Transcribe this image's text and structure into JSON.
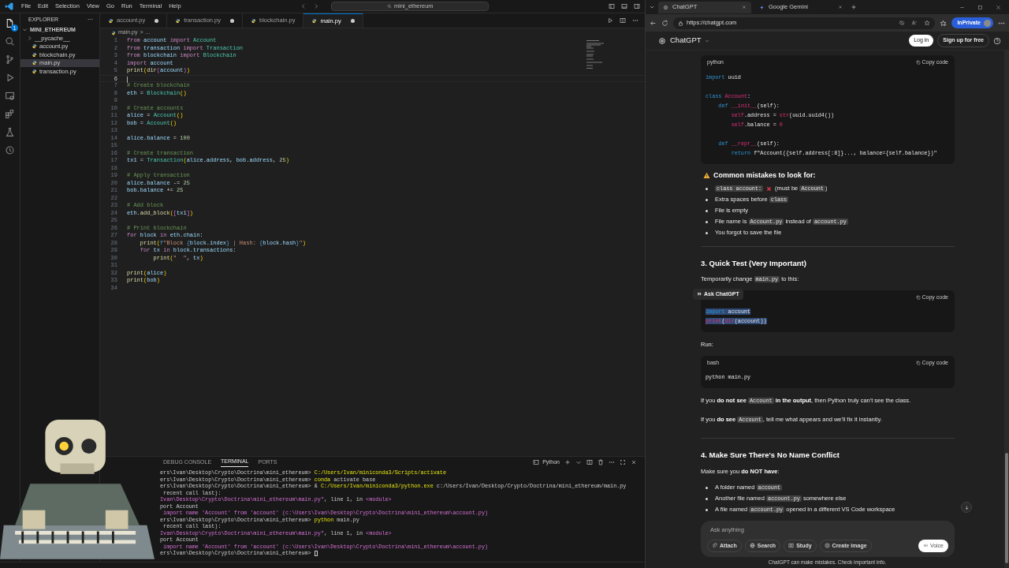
{
  "vscode": {
    "menu": [
      "File",
      "Edit",
      "Selection",
      "View",
      "Go",
      "Run",
      "Terminal",
      "Help"
    ],
    "search": "mini_ethereum",
    "activity_badge": "1",
    "explorer": {
      "title": "EXPLORER",
      "more": "···",
      "root": {
        "label": "MINI_ETHEREUM",
        "expanded": true,
        "children": [
          {
            "label": "__pycache__",
            "kind": "folder",
            "expanded": false,
            "selected": false
          },
          {
            "label": "account.py",
            "kind": "file",
            "selected": false
          },
          {
            "label": "blockchain.py",
            "kind": "file",
            "selected": false
          },
          {
            "label": "main.py",
            "kind": "file",
            "selected": true
          },
          {
            "label": "transaction.py",
            "kind": "file",
            "selected": false
          }
        ]
      }
    },
    "tabs": [
      {
        "label": "account.py",
        "modified": true,
        "selected": false
      },
      {
        "label": "transaction.py",
        "modified": true,
        "selected": false
      },
      {
        "label": "blockchain.py",
        "modified": false,
        "selected": false
      },
      {
        "label": "main.py",
        "modified": true,
        "selected": true
      }
    ],
    "breadcrumb": [
      "main.py",
      ">",
      "..."
    ],
    "lines": [
      {
        "n": "1",
        "current": false,
        "kind": "code",
        "t": [
          {
            "kind": "k",
            "text": "from "
          },
          {
            "kind": "v",
            "text": "account "
          },
          {
            "kind": "k",
            "text": "import "
          },
          {
            "kind": "c",
            "text": "Account"
          }
        ]
      },
      {
        "n": "2",
        "current": false,
        "kind": "code",
        "t": [
          {
            "kind": "k",
            "text": "from "
          },
          {
            "kind": "v",
            "text": "transaction "
          },
          {
            "kind": "k",
            "text": "import "
          },
          {
            "kind": "c",
            "text": "Transaction"
          }
        ]
      },
      {
        "n": "3",
        "current": false,
        "kind": "code",
        "t": [
          {
            "kind": "k",
            "text": "from "
          },
          {
            "kind": "v",
            "text": "blockchain "
          },
          {
            "kind": "k",
            "text": "import "
          },
          {
            "kind": "c",
            "text": "Blockchain"
          }
        ]
      },
      {
        "n": "4",
        "current": false,
        "kind": "code",
        "t": [
          {
            "kind": "k",
            "text": "import "
          },
          {
            "kind": "v",
            "text": "account"
          }
        ]
      },
      {
        "n": "5",
        "current": false,
        "kind": "code",
        "t": [
          {
            "kind": "f",
            "text": "print"
          },
          {
            "kind": "y",
            "text": "("
          },
          {
            "kind": "f",
            "text": "dir"
          },
          {
            "kind": "o",
            "text": "("
          },
          {
            "kind": "v",
            "text": "account"
          },
          {
            "kind": "o",
            "text": ")"
          },
          {
            "kind": "y",
            "text": ")"
          }
        ]
      },
      {
        "n": "6",
        "current": true,
        "kind": "blank"
      },
      {
        "n": "7",
        "current": false,
        "kind": "code",
        "t": [
          {
            "kind": "m",
            "text": "# Create blockchain"
          }
        ]
      },
      {
        "n": "8",
        "current": false,
        "kind": "code",
        "t": [
          {
            "kind": "v",
            "text": "eth "
          },
          {
            "kind": "p",
            "text": "= "
          },
          {
            "kind": "c",
            "text": "Blockchain"
          },
          {
            "kind": "y",
            "text": "()"
          }
        ]
      },
      {
        "n": "9",
        "current": false,
        "kind": "blank"
      },
      {
        "n": "10",
        "current": false,
        "kind": "code",
        "t": [
          {
            "kind": "m",
            "text": "# Create accounts"
          }
        ]
      },
      {
        "n": "11",
        "current": false,
        "kind": "code",
        "t": [
          {
            "kind": "v",
            "text": "alice "
          },
          {
            "kind": "p",
            "text": "= "
          },
          {
            "kind": "c",
            "text": "Account"
          },
          {
            "kind": "y",
            "text": "()"
          }
        ]
      },
      {
        "n": "12",
        "current": false,
        "kind": "code",
        "t": [
          {
            "kind": "v",
            "text": "bob "
          },
          {
            "kind": "p",
            "text": "= "
          },
          {
            "kind": "c",
            "text": "Account"
          },
          {
            "kind": "y",
            "text": "()"
          }
        ]
      },
      {
        "n": "13",
        "current": false,
        "kind": "blank"
      },
      {
        "n": "14",
        "current": false,
        "kind": "code",
        "t": [
          {
            "kind": "v",
            "text": "alice"
          },
          {
            "kind": "p",
            "text": "."
          },
          {
            "kind": "v",
            "text": "balance "
          },
          {
            "kind": "p",
            "text": "= "
          },
          {
            "kind": "n",
            "text": "100"
          }
        ]
      },
      {
        "n": "15",
        "current": false,
        "kind": "blank"
      },
      {
        "n": "16",
        "current": false,
        "kind": "code",
        "t": [
          {
            "kind": "m",
            "text": "# Create transaction"
          }
        ]
      },
      {
        "n": "17",
        "current": false,
        "kind": "code",
        "t": [
          {
            "kind": "v",
            "text": "tx1 "
          },
          {
            "kind": "p",
            "text": "= "
          },
          {
            "kind": "c",
            "text": "Transaction"
          },
          {
            "kind": "y",
            "text": "("
          },
          {
            "kind": "v",
            "text": "alice"
          },
          {
            "kind": "p",
            "text": "."
          },
          {
            "kind": "v",
            "text": "address"
          },
          {
            "kind": "p",
            "text": ", "
          },
          {
            "kind": "v",
            "text": "bob"
          },
          {
            "kind": "p",
            "text": "."
          },
          {
            "kind": "v",
            "text": "address"
          },
          {
            "kind": "p",
            "text": ", "
          },
          {
            "kind": "n",
            "text": "25"
          },
          {
            "kind": "y",
            "text": ")"
          }
        ]
      },
      {
        "n": "18",
        "current": false,
        "kind": "blank"
      },
      {
        "n": "19",
        "current": false,
        "kind": "code",
        "t": [
          {
            "kind": "m",
            "text": "# Apply transaction"
          }
        ]
      },
      {
        "n": "20",
        "current": false,
        "kind": "code",
        "t": [
          {
            "kind": "v",
            "text": "alice"
          },
          {
            "kind": "p",
            "text": "."
          },
          {
            "kind": "v",
            "text": "balance "
          },
          {
            "kind": "p",
            "text": "-= "
          },
          {
            "kind": "n",
            "text": "25"
          }
        ]
      },
      {
        "n": "21",
        "current": false,
        "kind": "code",
        "t": [
          {
            "kind": "v",
            "text": "bob"
          },
          {
            "kind": "p",
            "text": "."
          },
          {
            "kind": "v",
            "text": "balance "
          },
          {
            "kind": "p",
            "text": "+= "
          },
          {
            "kind": "n",
            "text": "25"
          }
        ]
      },
      {
        "n": "22",
        "current": false,
        "kind": "blank"
      },
      {
        "n": "23",
        "current": false,
        "kind": "code",
        "t": [
          {
            "kind": "m",
            "text": "# Add block"
          }
        ]
      },
      {
        "n": "24",
        "current": false,
        "kind": "code",
        "t": [
          {
            "kind": "v",
            "text": "eth"
          },
          {
            "kind": "p",
            "text": "."
          },
          {
            "kind": "f",
            "text": "add_block"
          },
          {
            "kind": "y",
            "text": "("
          },
          {
            "kind": "o",
            "text": "["
          },
          {
            "kind": "v",
            "text": "tx1"
          },
          {
            "kind": "o",
            "text": "]"
          },
          {
            "kind": "y",
            "text": ")"
          }
        ]
      },
      {
        "n": "25",
        "current": false,
        "kind": "blank"
      },
      {
        "n": "26",
        "current": false,
        "kind": "code",
        "t": [
          {
            "kind": "m",
            "text": "# Print blockchain"
          }
        ]
      },
      {
        "n": "27",
        "current": false,
        "kind": "code",
        "t": [
          {
            "kind": "k",
            "text": "for "
          },
          {
            "kind": "v",
            "text": "block "
          },
          {
            "kind": "k",
            "text": "in "
          },
          {
            "kind": "v",
            "text": "eth"
          },
          {
            "kind": "p",
            "text": "."
          },
          {
            "kind": "v",
            "text": "chain"
          },
          {
            "kind": "p",
            "text": ":"
          }
        ]
      },
      {
        "n": "28",
        "current": false,
        "kind": "code",
        "t": [
          {
            "kind": "f",
            "text": "    print"
          },
          {
            "kind": "y",
            "text": "("
          },
          {
            "kind": "b",
            "text": "f"
          },
          {
            "kind": "s",
            "text": "\"Block "
          },
          {
            "kind": "b",
            "text": "{"
          },
          {
            "kind": "v",
            "text": "block"
          },
          {
            "kind": "p",
            "text": "."
          },
          {
            "kind": "v",
            "text": "index"
          },
          {
            "kind": "b",
            "text": "}"
          },
          {
            "kind": "s",
            "text": " | Hash: "
          },
          {
            "kind": "b",
            "text": "{"
          },
          {
            "kind": "v",
            "text": "block"
          },
          {
            "kind": "p",
            "text": "."
          },
          {
            "kind": "v",
            "text": "hash"
          },
          {
            "kind": "b",
            "text": "}"
          },
          {
            "kind": "s",
            "text": "\""
          },
          {
            "kind": "y",
            "text": ")"
          }
        ]
      },
      {
        "n": "29",
        "current": false,
        "kind": "code",
        "t": [
          {
            "kind": "k",
            "text": "    for "
          },
          {
            "kind": "v",
            "text": "tx "
          },
          {
            "kind": "k",
            "text": "in "
          },
          {
            "kind": "v",
            "text": "block"
          },
          {
            "kind": "p",
            "text": "."
          },
          {
            "kind": "v",
            "text": "transactions"
          },
          {
            "kind": "p",
            "text": ":"
          }
        ]
      },
      {
        "n": "30",
        "current": false,
        "kind": "code",
        "t": [
          {
            "kind": "f",
            "text": "        print"
          },
          {
            "kind": "y",
            "text": "("
          },
          {
            "kind": "s",
            "text": "\"  \""
          },
          {
            "kind": "p",
            "text": ", "
          },
          {
            "kind": "v",
            "text": "tx"
          },
          {
            "kind": "y",
            "text": ")"
          }
        ]
      },
      {
        "n": "31",
        "current": false,
        "kind": "blank"
      },
      {
        "n": "32",
        "current": false,
        "kind": "code",
        "t": [
          {
            "kind": "f",
            "text": "print"
          },
          {
            "kind": "y",
            "text": "("
          },
          {
            "kind": "v",
            "text": "alice"
          },
          {
            "kind": "y",
            "text": ")"
          }
        ]
      },
      {
        "n": "33",
        "current": false,
        "kind": "code",
        "t": [
          {
            "kind": "f",
            "text": "print"
          },
          {
            "kind": "y",
            "text": "("
          },
          {
            "kind": "v",
            "text": "bob"
          },
          {
            "kind": "y",
            "text": ")"
          }
        ]
      },
      {
        "n": "34",
        "current": false,
        "kind": "blank"
      }
    ],
    "panel_tabs": [
      {
        "label": "DEBUG CONSOLE",
        "selected": false
      },
      {
        "label": "TERMINAL",
        "selected": true
      },
      {
        "label": "PORTS",
        "selected": false
      }
    ],
    "terminal_profile": "Python",
    "terminal": [
      [
        {
          "kind": "p",
          "text": "ers\\Ivan\\Desktop\\Crypto\\Doctrina\\mini_ethereum> "
        },
        {
          "kind": "y",
          "text": "C:/Users/Ivan/miniconda3/Scripts/activate"
        }
      ],
      [
        {
          "kind": "p",
          "text": "ers\\Ivan\\Desktop\\Crypto\\Doctrina\\mini_ethereum> "
        },
        {
          "kind": "y",
          "text": "conda "
        },
        {
          "kind": "p",
          "text": "activate base"
        }
      ],
      [
        {
          "kind": "p",
          "text": "ers\\Ivan\\Desktop\\Crypto\\Doctrina\\mini_ethereum> & "
        },
        {
          "kind": "y",
          "text": "C:/Users/Ivan/miniconda3/python.exe "
        },
        {
          "kind": "p",
          "text": "c:/Users/Ivan/Desktop/Crypto/Doctrina/mini_ethereum/main.py"
        }
      ],
      [
        {
          "kind": "p",
          "text": " recent call last):"
        }
      ],
      [
        {
          "kind": "r",
          "text": "Ivan\\Desktop\\Crypto\\Doctrina\\mini_ethereum\\main.py\""
        },
        {
          "kind": "p",
          "text": ", line 1, in "
        },
        {
          "kind": "r",
          "text": "<module>"
        }
      ],
      [
        {
          "kind": "p",
          "text": "port Account"
        }
      ],
      [
        {
          "kind": "r",
          "text": " import name 'Account' from 'account' (c:\\Users\\Ivan\\Desktop\\Crypto\\Doctrina\\mini_ethereum\\account.py)"
        }
      ],
      [
        {
          "kind": "p",
          "text": "ers\\Ivan\\Desktop\\Crypto\\Doctrina\\mini_ethereum> "
        },
        {
          "kind": "y",
          "text": "python "
        },
        {
          "kind": "p",
          "text": "main.py"
        }
      ],
      [
        {
          "kind": "p",
          "text": " recent call last):"
        }
      ],
      [
        {
          "kind": "r",
          "text": "Ivan\\Desktop\\Crypto\\Doctrina\\mini_ethereum\\main.py\""
        },
        {
          "kind": "p",
          "text": ", line 1, in "
        },
        {
          "kind": "r",
          "text": "<module>"
        }
      ],
      [
        {
          "kind": "p",
          "text": "port Account"
        }
      ],
      [
        {
          "kind": "r",
          "text": " import name 'Account' from 'account' (c:\\Users\\Ivan\\Desktop\\Crypto\\Doctrina\\mini_ethereum\\account.py)"
        }
      ],
      [
        {
          "kind": "p",
          "text": "ers\\Ivan\\Desktop\\Crypto\\Doctrina\\mini_ethereum> "
        }
      ]
    ]
  },
  "browser": {
    "tabs": [
      {
        "label": "ChatGPT",
        "selected": true
      },
      {
        "label": "Google Gemini",
        "selected": false
      }
    ],
    "url": "https://chatgpt.com",
    "inprivate": "InPrivate"
  },
  "chat": {
    "brand": "ChatGPT",
    "login": "Log in",
    "signup": "Sign up for free",
    "blocks": [
      {
        "kind": "code",
        "lang": "python",
        "copy": "Copy code",
        "selected": false,
        "lines": [
          {
            "kind": "code",
            "t": [
              {
                "kind": "k",
                "text": "import "
              },
              {
                "kind": "p",
                "text": "uuid"
              }
            ]
          },
          {
            "kind": "blank"
          },
          {
            "kind": "code",
            "t": [
              {
                "kind": "k",
                "text": "class "
              },
              {
                "kind": "r",
                "text": "Account"
              },
              {
                "kind": "p",
                "text": ":"
              }
            ]
          },
          {
            "kind": "code",
            "t": [
              {
                "kind": "k",
                "text": "    def "
              },
              {
                "kind": "r",
                "text": "__init__"
              },
              {
                "kind": "p",
                "text": "(self):"
              }
            ]
          },
          {
            "kind": "code",
            "t": [
              {
                "kind": "r",
                "text": "        self"
              },
              {
                "kind": "p",
                "text": ".address = "
              },
              {
                "kind": "r",
                "text": "str"
              },
              {
                "kind": "p",
                "text": "(uuid.uuid4())"
              }
            ]
          },
          {
            "kind": "code",
            "t": [
              {
                "kind": "r",
                "text": "        self"
              },
              {
                "kind": "p",
                "text": ".balance = "
              },
              {
                "kind": "r",
                "text": "0"
              }
            ]
          },
          {
            "kind": "blank"
          },
          {
            "kind": "code",
            "t": [
              {
                "kind": "k",
                "text": "    def "
              },
              {
                "kind": "r",
                "text": "__repr__"
              },
              {
                "kind": "p",
                "text": "(self):"
              }
            ]
          },
          {
            "kind": "code",
            "t": [
              {
                "kind": "k",
                "text": "        return "
              },
              {
                "kind": "p",
                "text": "f\"Account({self.address[:8]}..., balance={self.balance})\""
              }
            ]
          }
        ]
      },
      {
        "kind": "heading",
        "parts": [
          {
            "kind": "t",
            "text": "Common mistakes to look for:"
          }
        ]
      },
      {
        "kind": "bullets",
        "items": [
          [
            {
              "kind": "c",
              "text": "class account:"
            },
            {
              "kind": "x"
            },
            {
              "kind": "t",
              "text": " (must be "
            },
            {
              "kind": "c",
              "text": "Account"
            },
            {
              "kind": "t",
              "text": ")"
            }
          ],
          [
            {
              "kind": "t",
              "text": "Extra spaces before "
            },
            {
              "kind": "c",
              "text": "class"
            }
          ],
          [
            {
              "kind": "t",
              "text": "File is empty"
            }
          ],
          [
            {
              "kind": "t",
              "text": "File name is "
            },
            {
              "kind": "c",
              "text": "Account.py"
            },
            {
              "kind": "t",
              "text": " instead of "
            },
            {
              "kind": "c",
              "text": "account.py"
            }
          ],
          [
            {
              "kind": "t",
              "text": "You forgot to save the file"
            }
          ]
        ]
      },
      {
        "kind": "rule"
      },
      {
        "kind": "title",
        "parts": [
          {
            "kind": "t",
            "text": "3. Quick Test (Very Important)"
          }
        ]
      },
      {
        "kind": "para",
        "parts": [
          {
            "kind": "t",
            "text": "Temporarily change "
          },
          {
            "kind": "c",
            "text": "main.py"
          },
          {
            "kind": "t",
            "text": " to this:"
          }
        ]
      },
      {
        "kind": "code",
        "copy": "Copy code",
        "selected": true,
        "popup": "Ask ChatGPT",
        "lines": [
          {
            "kind": "code",
            "t": [
              {
                "kind": "k",
                "text": "import "
              },
              {
                "kind": "p",
                "text": "account"
              }
            ]
          },
          {
            "kind": "code",
            "t": [
              {
                "kind": "r",
                "text": "print"
              },
              {
                "kind": "p",
                "text": "("
              },
              {
                "kind": "r",
                "text": "dir"
              },
              {
                "kind": "p",
                "text": "(account))"
              }
            ]
          }
        ]
      },
      {
        "kind": "para",
        "parts": [
          {
            "kind": "t",
            "text": "Run:"
          }
        ]
      },
      {
        "kind": "code",
        "lang": "bash",
        "copy": "Copy code",
        "selected": false,
        "lines": [
          {
            "kind": "code",
            "t": [
              {
                "kind": "p",
                "text": "python main.py"
              }
            ]
          }
        ]
      },
      {
        "kind": "para",
        "parts": [
          {
            "kind": "t",
            "text": "If you "
          },
          {
            "kind": "b",
            "text": "do not see "
          },
          {
            "kind": "c",
            "text": "Account"
          },
          {
            "kind": "b",
            "text": " in the output"
          },
          {
            "kind": "t",
            "text": ", then Python truly can't see the class."
          }
        ]
      },
      {
        "kind": "para",
        "parts": [
          {
            "kind": "t",
            "text": "If you "
          },
          {
            "kind": "b",
            "text": "do see "
          },
          {
            "kind": "c",
            "text": "Account"
          },
          {
            "kind": "t",
            "text": ", tell me what appears and we'll fix it instantly."
          }
        ]
      },
      {
        "kind": "rule"
      },
      {
        "kind": "title",
        "parts": [
          {
            "kind": "t",
            "text": "4. Make Sure There's No Name Conflict"
          }
        ]
      },
      {
        "kind": "para",
        "parts": [
          {
            "kind": "t",
            "text": "Make sure you "
          },
          {
            "kind": "b",
            "text": "do NOT have"
          },
          {
            "kind": "t",
            "text": ":"
          }
        ]
      },
      {
        "kind": "bullets",
        "items": [
          [
            {
              "kind": "t",
              "text": "A folder named "
            },
            {
              "kind": "c",
              "text": "account"
            }
          ],
          [
            {
              "kind": "t",
              "text": "Another file named "
            },
            {
              "kind": "c",
              "text": "account.py"
            },
            {
              "kind": "t",
              "text": " somewhere else"
            }
          ],
          [
            {
              "kind": "t",
              "text": "A file named "
            },
            {
              "kind": "c",
              "text": "account.py"
            },
            {
              "kind": "t",
              "text": " opened in a different VS Code workspace"
            }
          ]
        ]
      }
    ],
    "input": {
      "placeholder": "Ask anything"
    },
    "tools": [
      "Attach",
      "Search",
      "Study",
      "Create image"
    ],
    "voice": "Voice",
    "disclaimer": "ChatGPT can make mistakes. Check important info."
  }
}
